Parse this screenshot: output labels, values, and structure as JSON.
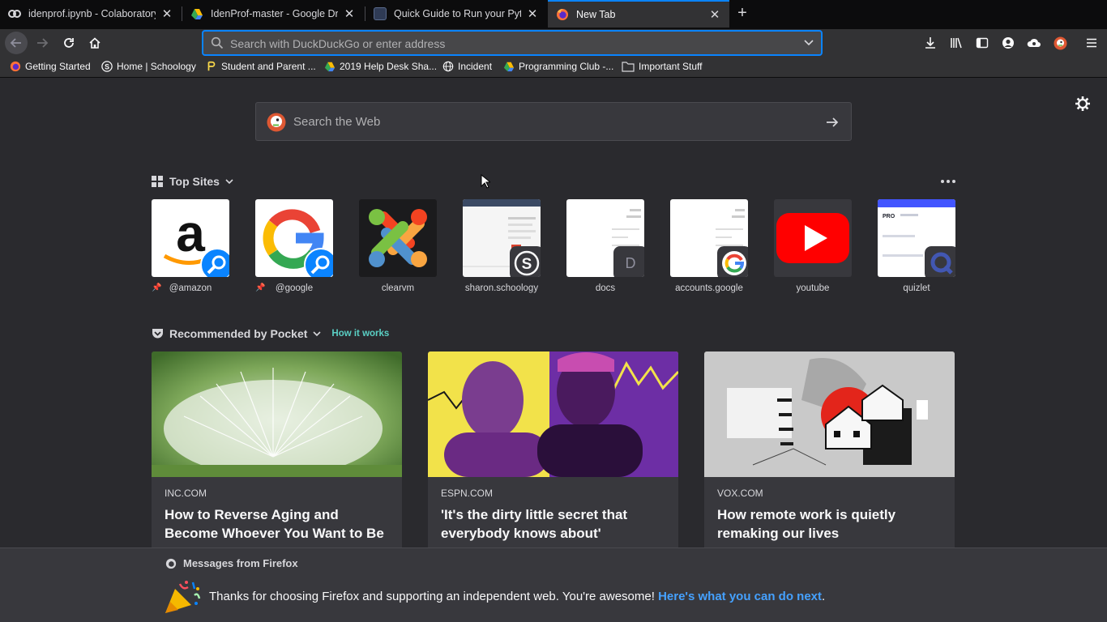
{
  "tabs": [
    {
      "title": "idenprof.ipynb - Colaboratory",
      "icon": "colab-icon",
      "active": false
    },
    {
      "title": "IdenProf-master - Google Drive",
      "icon": "google-drive-icon",
      "active": false
    },
    {
      "title": "Quick Guide to Run your Python",
      "icon": "page-thumbnail-icon",
      "active": false
    },
    {
      "title": "New Tab",
      "icon": "firefox-icon",
      "active": true
    }
  ],
  "urlbar": {
    "placeholder": "Search with DuckDuckGo or enter address"
  },
  "bookmarks": [
    {
      "label": "Getting Started",
      "icon": "firefox-icon"
    },
    {
      "label": "Home | Schoology",
      "icon": "schoology-icon"
    },
    {
      "label": "Student and Parent ...",
      "icon": "powerschool-icon"
    },
    {
      "label": "2019 Help Desk Sha...",
      "icon": "google-drive-icon"
    },
    {
      "label": "Incident",
      "icon": "globe-icon"
    },
    {
      "label": "Programming Club -...",
      "icon": "google-drive-icon"
    },
    {
      "label": "Important Stuff",
      "icon": "folder-icon"
    }
  ],
  "search": {
    "placeholder": "Search the Web"
  },
  "top_sites": {
    "heading": "Top Sites",
    "sites": [
      {
        "label": "@amazon",
        "pinned": true,
        "icon": "amazon-icon"
      },
      {
        "label": "@google",
        "pinned": true,
        "icon": "google-icon"
      },
      {
        "label": "clearvm",
        "pinned": false,
        "icon": "joomla-icon"
      },
      {
        "label": "sharon.schoology",
        "pinned": false,
        "icon": "schoology-icon"
      },
      {
        "label": "docs",
        "pinned": false,
        "icon": "letter-d-icon",
        "badge_letter": "D"
      },
      {
        "label": "accounts.google",
        "pinned": false,
        "icon": "google-icon"
      },
      {
        "label": "youtube",
        "pinned": false,
        "icon": "youtube-icon"
      },
      {
        "label": "quizlet",
        "pinned": false,
        "icon": "quizlet-icon"
      }
    ]
  },
  "pocket": {
    "heading": "Recommended by Pocket",
    "how_it_works": "How it works",
    "cards": [
      {
        "source": "INC.COM",
        "title": "How to Reverse Aging and Become Whoever You Want to Be"
      },
      {
        "source": "ESPN.COM",
        "title": "'It's the dirty little secret that everybody knows about'"
      },
      {
        "source": "VOX.COM",
        "title": "How remote work is quietly remaking our lives"
      }
    ]
  },
  "messages": {
    "heading": "Messages from Firefox",
    "text": "Thanks for choosing Firefox and supporting an independent web. You're awesome!",
    "link": "Here's what you can do next",
    "trailing": "."
  },
  "colors": {
    "accent": "#0a84ff",
    "link": "#45a1ff",
    "pocket_link": "#5ad0c5"
  }
}
